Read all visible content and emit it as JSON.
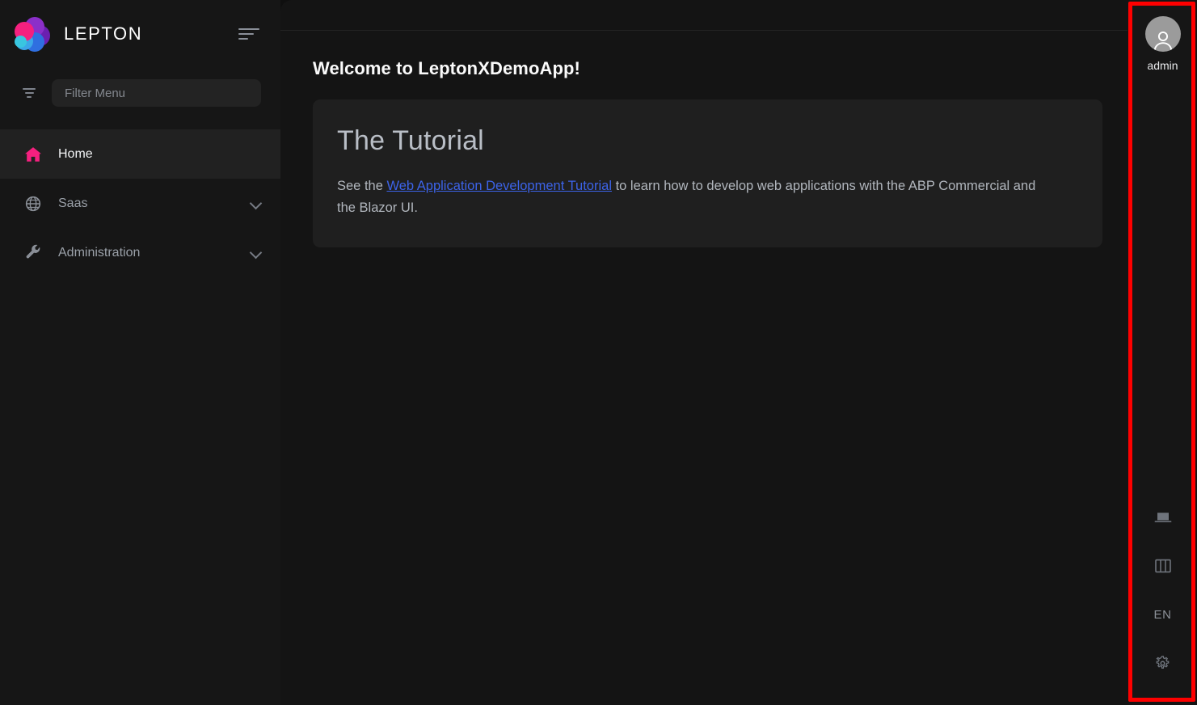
{
  "sidebar": {
    "brand": {
      "name": "LEPTON",
      "logo_icon": "lepton-logo-icon"
    },
    "menu_toggle_icon": "hamburger-menu-icon",
    "filter": {
      "icon": "filter-funnel-icon",
      "placeholder": "Filter Menu",
      "value": ""
    },
    "items": [
      {
        "label": "Home",
        "icon": "home-icon",
        "active": true,
        "expandable": false
      },
      {
        "label": "Saas",
        "icon": "globe-icon",
        "active": false,
        "expandable": true
      },
      {
        "label": "Administration",
        "icon": "wrench-icon",
        "active": false,
        "expandable": true
      }
    ]
  },
  "main": {
    "page_title": "Welcome to LeptonXDemoApp!",
    "card": {
      "title": "The Tutorial",
      "text_before": "See the ",
      "link_text": "Web Application Development Tutorial",
      "text_after": " to learn how to develop web applications with the ABP Commercial and the Blazor UI."
    }
  },
  "right_sidebar": {
    "user": {
      "name": "admin",
      "avatar_icon": "user-avatar-icon"
    },
    "tools": [
      {
        "name": "laptop-icon",
        "label": ""
      },
      {
        "name": "columns-layout-icon",
        "label": ""
      },
      {
        "name": "language-selector",
        "label": "EN"
      },
      {
        "name": "gear-icon",
        "label": ""
      }
    ]
  },
  "colors": {
    "accent_pink": "#f5207f",
    "link_blue": "#3c63e8",
    "highlight_red": "#fe0000",
    "sidebar_bg": "#161616",
    "content_bg": "#141414",
    "card_bg": "#1f1f1f"
  }
}
